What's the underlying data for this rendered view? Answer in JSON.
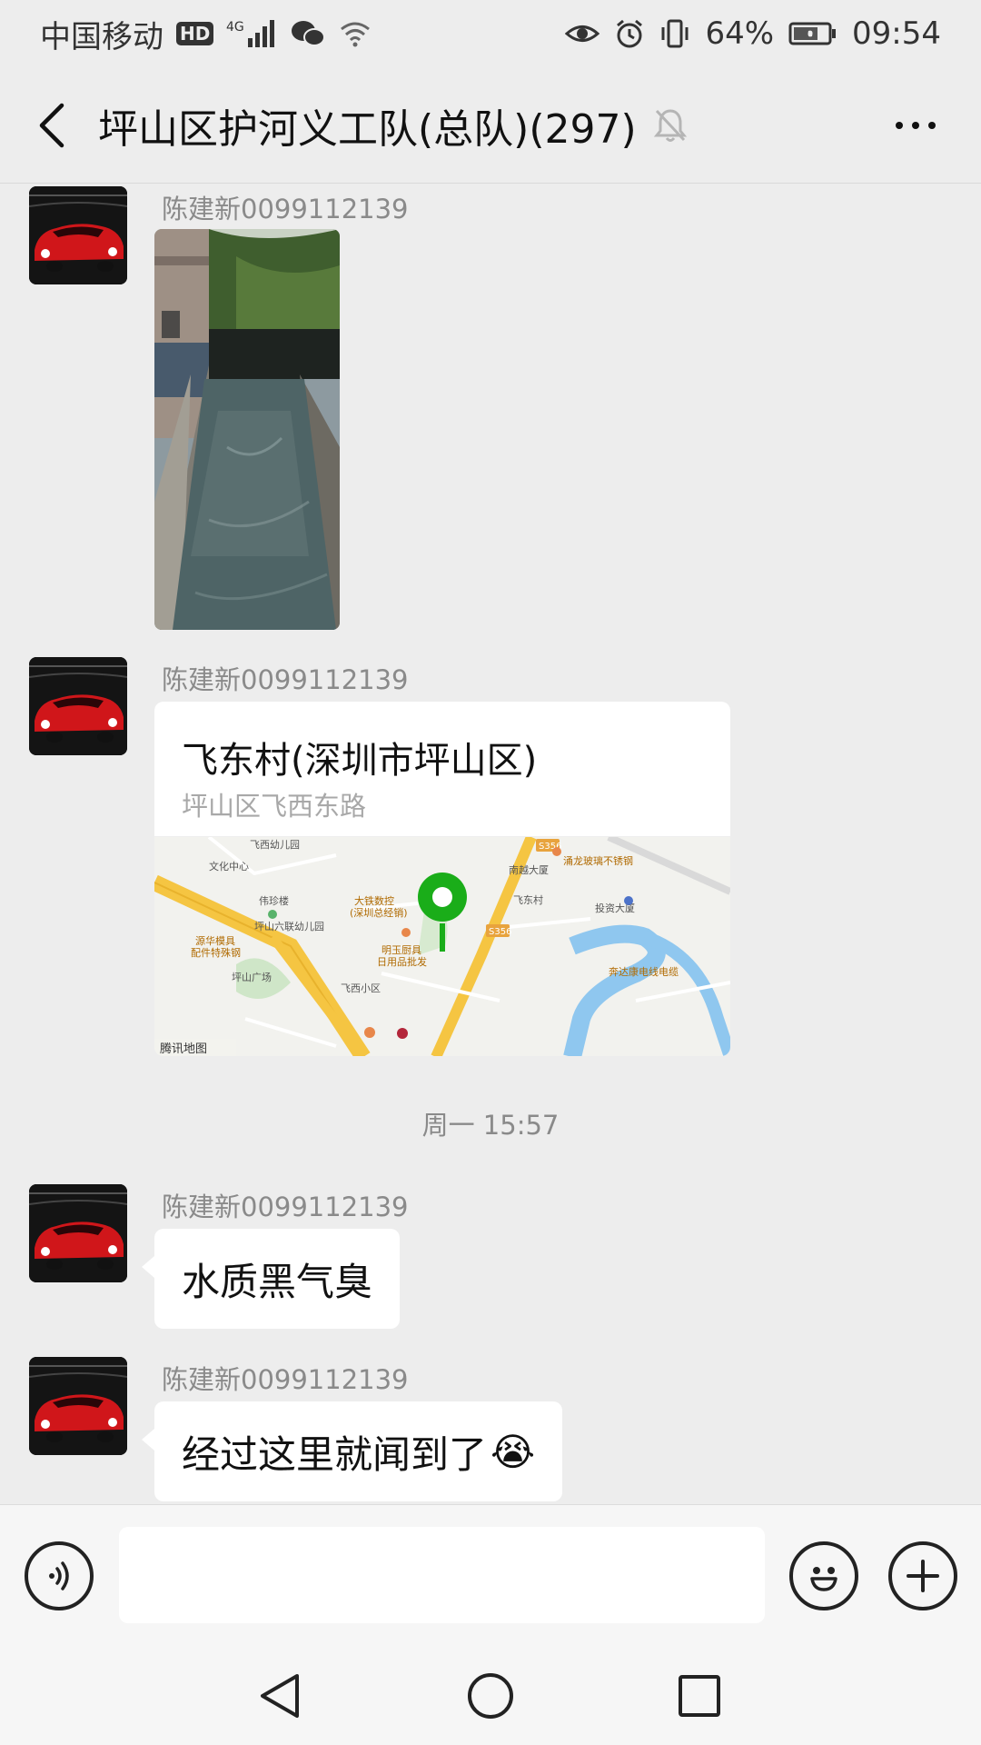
{
  "status_bar": {
    "carrier": "中国移动",
    "hd_badge": "HD",
    "network_type": "4G",
    "battery": "64%",
    "time": "09:54"
  },
  "header": {
    "title": "坪山区护河义工队(总队)(297)"
  },
  "messages": [
    {
      "sender": "陈建新0099112139",
      "type": "image"
    },
    {
      "sender": "陈建新0099112139",
      "type": "location",
      "location_name": "飞东村(深圳市坪山区)",
      "location_address": "坪山区飞西东路",
      "map_attribution": "腾讯地图",
      "map_labels": [
        "飞西幼儿园",
        "文化中心",
        "伟珍楼",
        "大铁数控",
        "(深圳总经销)",
        "坪山六联幼儿园",
        "南越大厦",
        "涌龙玻璃不锈钢",
        "飞东村",
        "投资大厦",
        "源华模具",
        "配件特殊钢",
        "明玉厨具",
        "日用品批发",
        "坪山广场",
        "飞西小区",
        "奔达康电线电缆",
        "S356"
      ]
    },
    {
      "timestamp": "周一 15:57"
    },
    {
      "sender": "陈建新0099112139",
      "type": "text",
      "text": "水质黑气臭"
    },
    {
      "sender": "陈建新0099112139",
      "type": "text",
      "text": "经过这里就闻到了",
      "emoji": "😭"
    }
  ],
  "input_bar": {
    "value": ""
  },
  "colors": {
    "background": "#ededed",
    "bubble": "#ffffff",
    "map_pin": "#1aad19",
    "road": "#f5c542"
  }
}
